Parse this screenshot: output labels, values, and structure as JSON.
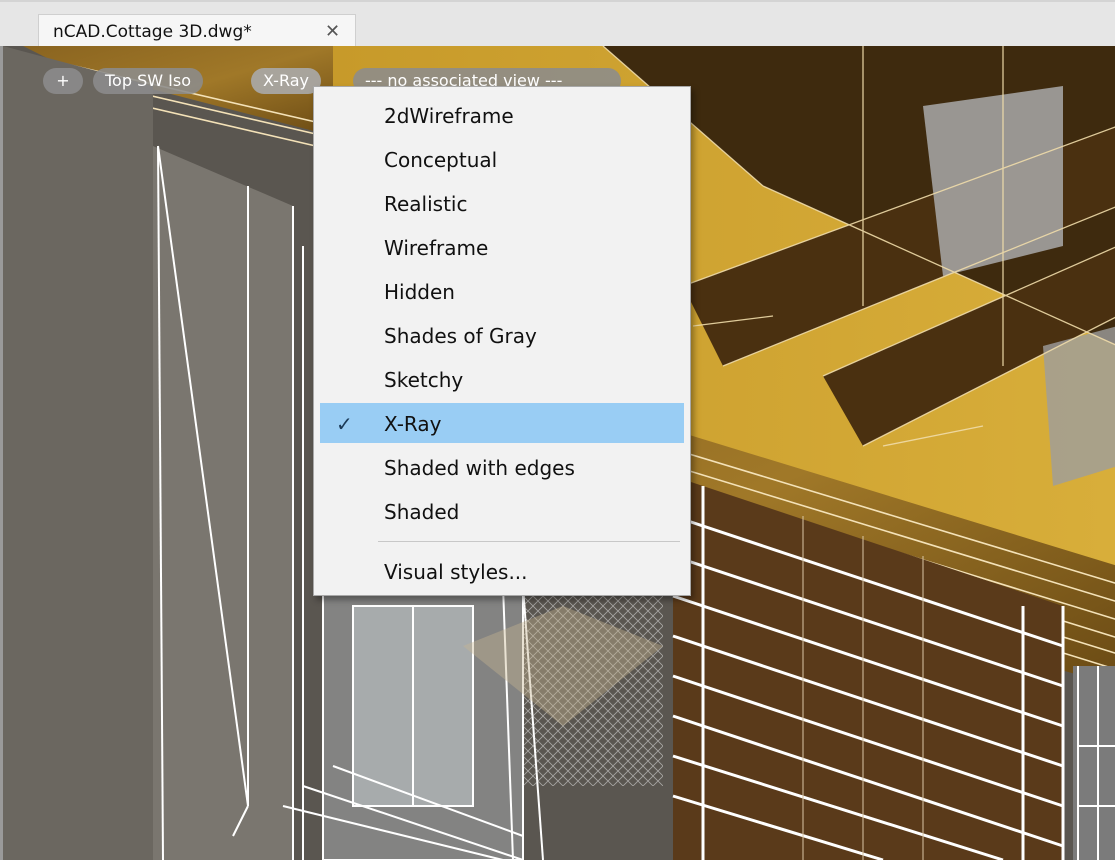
{
  "document_tab": {
    "title": "nCAD.Cottage 3D.dwg*",
    "close_symbol": "✕"
  },
  "viewport_controls": {
    "plus_label": "+",
    "view_label": "Top SW Iso",
    "style_label": "X-Ray",
    "associated_view_label": "--- no associated view ---"
  },
  "menu": {
    "selected": "X-Ray",
    "check_symbol": "✓",
    "items": [
      {
        "label": "2dWireframe"
      },
      {
        "label": "Conceptual"
      },
      {
        "label": "Realistic"
      },
      {
        "label": "Wireframe"
      },
      {
        "label": "Hidden"
      },
      {
        "label": "Shades of Gray"
      },
      {
        "label": "Sketchy"
      },
      {
        "label": "X-Ray"
      },
      {
        "label": "Shaded with edges"
      },
      {
        "label": "Shaded"
      }
    ],
    "footer_label": "Visual styles..."
  },
  "colors": {
    "menu_background": "#f2f2f2",
    "selection_highlight": "#99cdf4",
    "model_wood": "#7a5418",
    "model_wall": "#6e6a64"
  },
  "icons": [
    "close-icon",
    "checkmark-icon"
  ]
}
